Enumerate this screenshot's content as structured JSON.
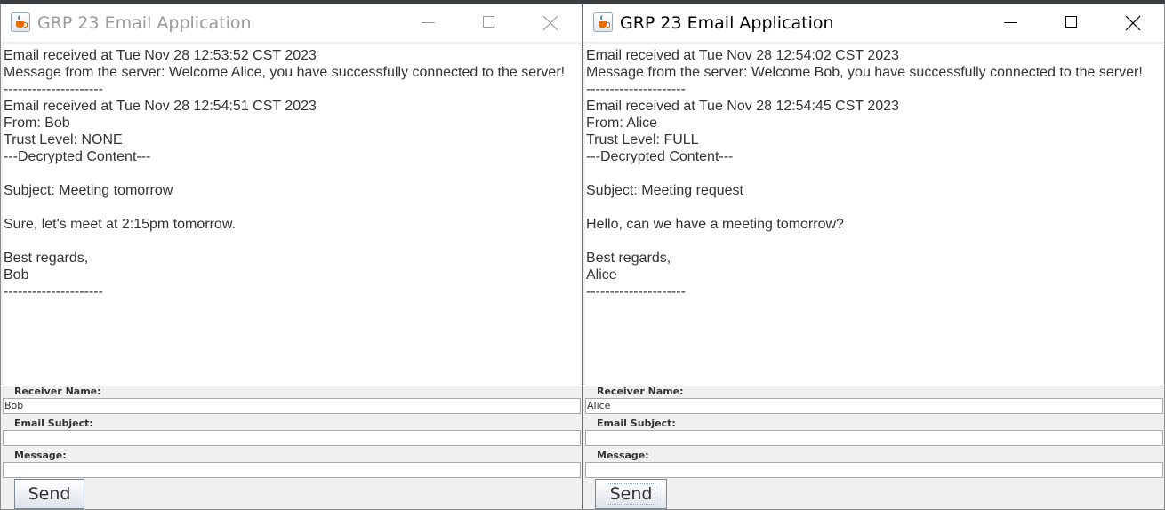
{
  "windows": [
    {
      "title": "GRP 23 Email Application",
      "active": false,
      "log": "Email received at Tue Nov 28 12:53:52 CST 2023\nMessage from the server: Welcome Alice, you have successfully connected to the server!\n---------------------\nEmail received at Tue Nov 28 12:54:51 CST 2023\nFrom: Bob\nTrust Level: NONE\n---Decrypted Content---\n\nSubject: Meeting tomorrow\n\nSure, let's meet at 2:15pm tomorrow.\n\nBest regards,\nBob\n---------------------",
      "form": {
        "receiver_label": "Receiver Name:",
        "receiver_value": "Bob",
        "subject_label": "Email Subject:",
        "subject_value": "",
        "message_label": "Message:",
        "message_value": "",
        "send_label": "Send"
      }
    },
    {
      "title": "GRP 23 Email Application",
      "active": true,
      "log": "Email received at Tue Nov 28 12:54:02 CST 2023\nMessage from the server: Welcome Bob, you have successfully connected to the server!\n---------------------\nEmail received at Tue Nov 28 12:54:45 CST 2023\nFrom: Alice\nTrust Level: FULL\n---Decrypted Content---\n\nSubject: Meeting request\n\nHello, can we have a meeting tomorrow?\n\nBest regards,\nAlice\n---------------------",
      "form": {
        "receiver_label": "Receiver Name:",
        "receiver_value": "Alice",
        "subject_label": "Email Subject:",
        "subject_value": "",
        "message_label": "Message:",
        "message_value": "",
        "send_label": "Send"
      }
    }
  ],
  "icons": {
    "app": "java-coffee-cup-icon",
    "minimize": "minimize-icon",
    "maximize": "maximize-icon",
    "close": "close-icon"
  },
  "colors": {
    "window_bg": "#f0f0f0",
    "text": "#333333",
    "inactive_title": "#9a9a9a"
  }
}
